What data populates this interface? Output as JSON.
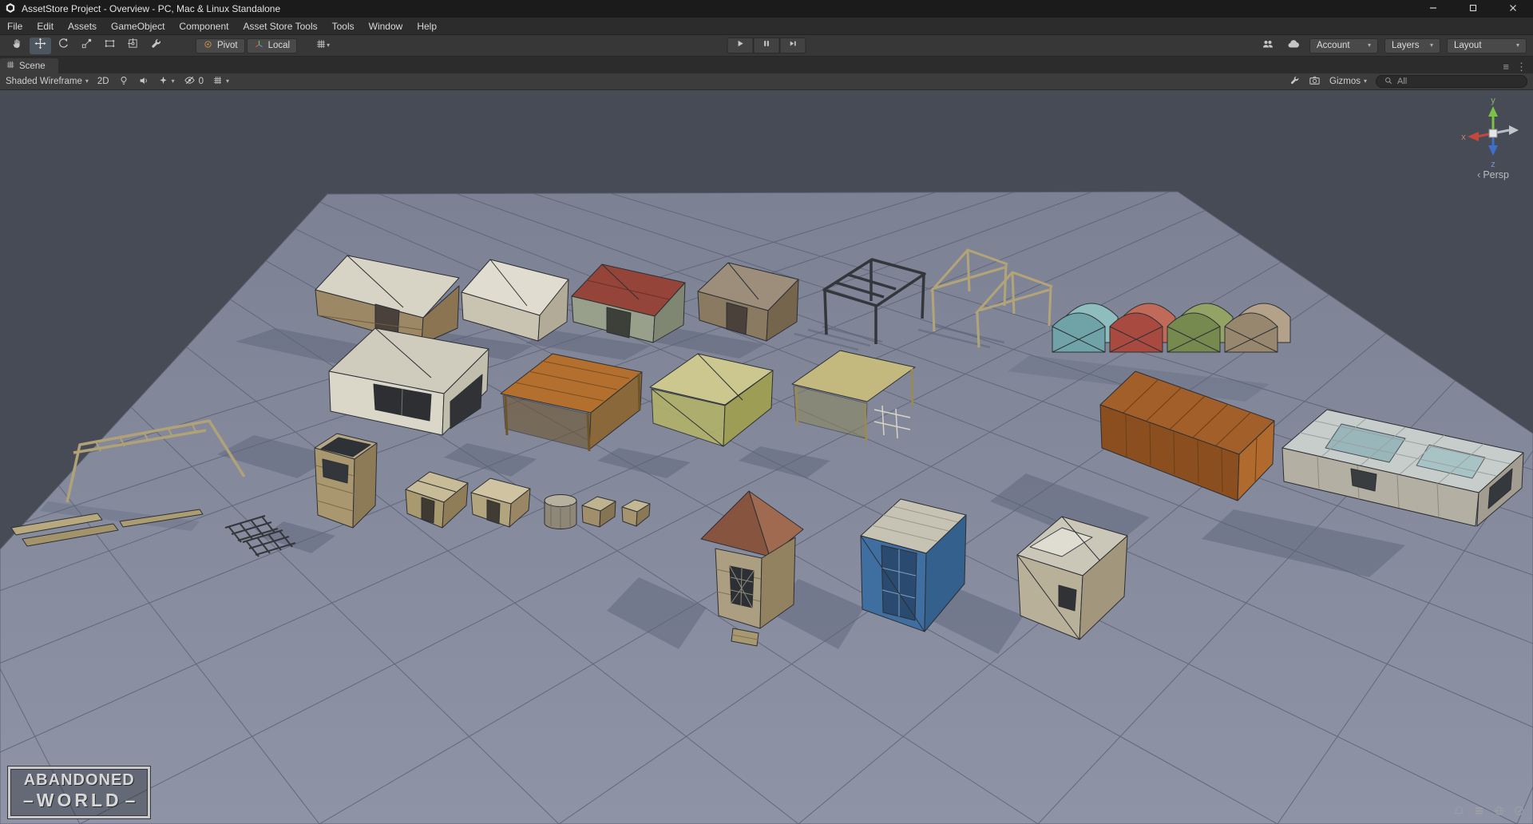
{
  "window": {
    "title": "AssetStore Project - Overview - PC, Mac & Linux Standalone"
  },
  "menu_bar": {
    "items": [
      "File",
      "Edit",
      "Assets",
      "GameObject",
      "Component",
      "Asset Store Tools",
      "Tools",
      "Window",
      "Help"
    ]
  },
  "toolbar": {
    "pivot": "Pivot",
    "local": "Local",
    "account": "Account",
    "layers": "Layers",
    "layout": "Layout"
  },
  "scene_tab": {
    "label": "Scene"
  },
  "scene_toolbar": {
    "draw_mode": "Shaded Wireframe",
    "mode_2d": "2D",
    "hidden_objects_count": "0",
    "gizmos": "Gizmos",
    "search_value": "All"
  },
  "viewport": {
    "axis": {
      "x": "x",
      "y": "y",
      "z": "z"
    },
    "projection": "Persp",
    "watermark": {
      "line1": "ABANDONED",
      "line2": "WORLD",
      "dash": "–"
    }
  },
  "icons": {
    "dropdown_caret": "▾",
    "persp_caret": "‹",
    "tab_menu_glyph": "≡",
    "tab_kebab_glyph": "⋮"
  },
  "colors": {
    "titlebar": "#1b1b1b",
    "toolbar": "#373737",
    "ground": "#8a90a2",
    "sky": "#474b55",
    "grid_line": "#5e6476",
    "selected_tool": "#4d565e"
  }
}
